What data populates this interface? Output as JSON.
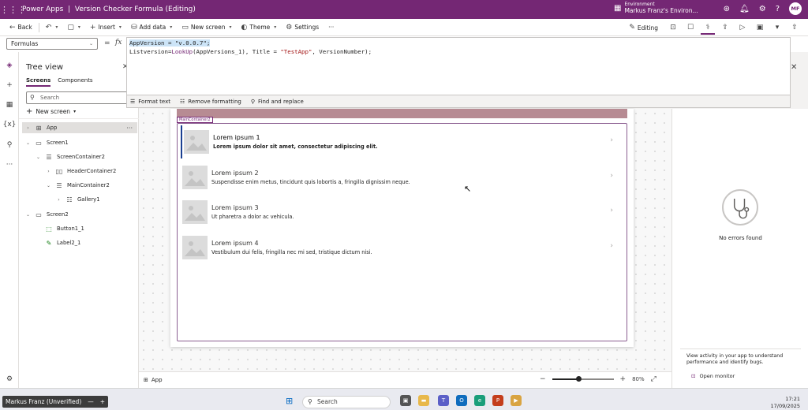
{
  "titlebar": {
    "app_name": "Power Apps",
    "separator": "|",
    "doc_title": "Version Checker Formula (Editing)",
    "env_label": "Environment",
    "env_name": "Markus Franz's Environ...",
    "avatar_initials": "MF"
  },
  "commandbar": {
    "back": "Back",
    "insert": "Insert",
    "add_data": "Add data",
    "new_screen": "New screen",
    "theme": "Theme",
    "settings": "Settings",
    "more": "···",
    "editing": "Editing"
  },
  "formula": {
    "property": "Formulas",
    "equals": "=",
    "fx": "fx",
    "line1_sel": "AppVersion = \"v.0.0.7\";",
    "line2_a": "Listversion=",
    "line2_fn": "LookUp",
    "line2_b": "(AppVersions_1), Title = ",
    "line2_str": "\"TestApp\"",
    "line2_c": ", VersionNumber);",
    "tools": {
      "format_text": "Format text",
      "remove_formatting": "Remove formatting",
      "find_replace": "Find and replace"
    }
  },
  "tree": {
    "title": "Tree view",
    "tab_screens": "Screens",
    "tab_components": "Components",
    "search_placeholder": "Search",
    "new_screen": "New screen",
    "nodes": [
      "App",
      "Screen1",
      "ScreenContainer2",
      "HeaderContainer2",
      "MainContainer2",
      "Gallery1",
      "Screen2",
      "Button1_1",
      "Label2_1"
    ]
  },
  "canvas": {
    "main_container_tag": "MainContainer2",
    "gallery": [
      {
        "title": "Lorem ipsum 1",
        "subtitle": "Lorem ipsum dolor sit amet, consectetur adipiscing elit."
      },
      {
        "title": "Lorem ipsum 2",
        "subtitle": "Suspendisse enim metus, tincidunt quis lobortis a, fringilla dignissim neque."
      },
      {
        "title": "Lorem ipsum 3",
        "subtitle": "Ut pharetra a dolor ac vehicula."
      },
      {
        "title": "Lorem ipsum 4",
        "subtitle": "Vestibulum dui felis, fringilla nec mi sed, tristique dictum nisi."
      }
    ]
  },
  "rightpanel": {
    "no_errors": "No errors found",
    "activity": "View activity in your app to understand performance and identify bugs.",
    "open_monitor": "Open monitor"
  },
  "statusbar": {
    "crumb": "App",
    "zoom": "80%",
    "zoom_level": 0.44
  },
  "taskbar": {
    "user": "Markus Franz (Unverified)",
    "search": "Search",
    "time": "17:21",
    "date": "17/09/2025"
  },
  "colors": {
    "brand": "#742774",
    "header_band": "#b78b93",
    "selection": "#cce4f7"
  }
}
